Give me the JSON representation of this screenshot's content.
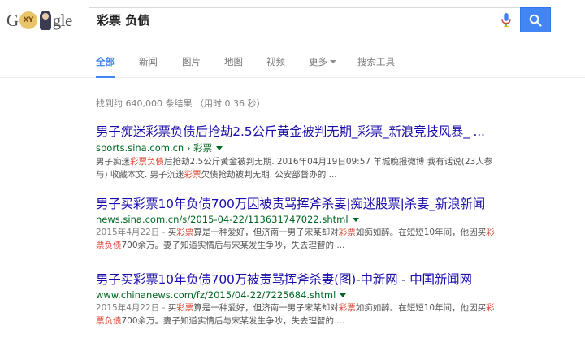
{
  "logo": {
    "prefix": "G",
    "badge": "XY",
    "suffix": "gle"
  },
  "search": {
    "query": "彩票 负债"
  },
  "tabs": [
    {
      "label": "全部",
      "active": true
    },
    {
      "label": "新闻",
      "active": false
    },
    {
      "label": "图片",
      "active": false
    },
    {
      "label": "地图",
      "active": false
    },
    {
      "label": "视频",
      "active": false
    },
    {
      "label": "更多",
      "active": false,
      "dropdown": true
    },
    {
      "label": "搜索工具",
      "active": false
    }
  ],
  "stats": "找到约 640,000 条结果 （用时 0.36 秒）",
  "results": [
    {
      "title": "男子痴迷彩票负债后抢劫2.5公斤黃金被判无期_彩票_新浪竞技风暴_ ...",
      "url": "sports.sina.com.cn › 彩票",
      "line1": [
        {
          "text": "男子痴迷",
          "hl": false
        },
        {
          "text": "彩票负债",
          "hl": true
        },
        {
          "text": "后抢劫2.5公斤黃金被判无期. 2016年04月19日09:57 羊城晚报微博 我有话说(23人参",
          "hl": false
        }
      ],
      "line2": [
        {
          "text": "与) 收藏本文. 男子沉迷",
          "hl": false
        },
        {
          "text": "彩票",
          "hl": true
        },
        {
          "text": "欠债抢劫被判无期. 公安部督办的 ...",
          "hl": false
        }
      ]
    },
    {
      "title": "男子买彩票10年负债700万因被责骂挥斧杀妻|痴迷股票|杀妻_新浪新闻",
      "url": "news.sina.com.cn/s/2015-04-22/113631747022.shtml",
      "line1": [
        {
          "text": "2015年4月22日 - ",
          "hl": false,
          "date": true
        },
        {
          "text": "买",
          "hl": false
        },
        {
          "text": "彩票",
          "hl": true
        },
        {
          "text": "算是一种爱好，但济南一男子宋某却对",
          "hl": false
        },
        {
          "text": "彩票",
          "hl": true
        },
        {
          "text": "如痴如醉。在短短10年间，他因买",
          "hl": false
        },
        {
          "text": "彩",
          "hl": true
        }
      ],
      "line2": [
        {
          "text": "票负债",
          "hl": true
        },
        {
          "text": "700余万。妻子知道实情后与宋某发生争吵，失去理智的 ...",
          "hl": false
        }
      ]
    },
    {
      "title": "男子买彩票10年负债700万被责骂挥斧杀妻(图)-中新网 - 中国新闻网",
      "url": "www.chinanews.com/fz/2015/04-22/7225684.shtml",
      "line1": [
        {
          "text": "2015年4月22日 - ",
          "hl": false,
          "date": true
        },
        {
          "text": "买",
          "hl": false
        },
        {
          "text": "彩票",
          "hl": true
        },
        {
          "text": "算是一种爱好，但济南一男子宋某却对",
          "hl": false
        },
        {
          "text": "彩票",
          "hl": true
        },
        {
          "text": "如痴如醉。在短短10年间，他因买",
          "hl": false
        },
        {
          "text": "彩",
          "hl": true
        }
      ],
      "line2": [
        {
          "text": "票负债",
          "hl": true
        },
        {
          "text": "700余万。妻子知道实情后与宋某发生争吵，失去理智的 ...",
          "hl": false
        }
      ]
    }
  ],
  "colors": {
    "accent": "#4285f4",
    "title_link": "#1a0dab",
    "url": "#006621",
    "highlight": "#dd4b39",
    "snippet": "#545454"
  }
}
